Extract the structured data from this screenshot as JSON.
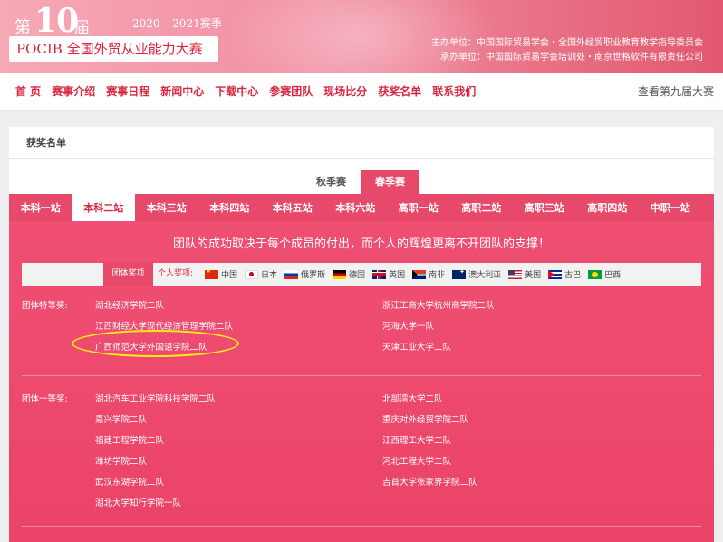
{
  "header": {
    "edition_prefix": "第",
    "edition_number": "10",
    "edition_suffix": "届",
    "season": "2020 – 2021赛季",
    "logo": "POCIB 全国外贸从业能力大赛",
    "organizer_line": "主办单位：中国国际贸易学会・全国外经贸职业教育教学指导委员会",
    "undertaker_line": "承办单位：中国国际贸易学会培训处・南京世格软件有限责任公司"
  },
  "nav": {
    "items": [
      "首 页",
      "赛事介绍",
      "赛事日程",
      "新闻中心",
      "下载中心",
      "参赛团队",
      "现场比分",
      "获奖名单",
      "联系我们"
    ],
    "right": "查看第九届大赛"
  },
  "panel": {
    "title": "获奖名单",
    "season_tabs": [
      "秋季赛",
      "春季赛"
    ],
    "active_season": "春季赛",
    "stations": [
      "本科一站",
      "本科二站",
      "本科三站",
      "本科四站",
      "本科五站",
      "本科六站",
      "高职一站",
      "高职二站",
      "高职三站",
      "高职四站",
      "中职一站"
    ],
    "active_station": "本科二站",
    "slogan": "团队的成功取决于每个成员的付出，而个人的辉煌更离不开团队的支撑！",
    "filter": {
      "team_award": "团体奖项",
      "personal_award": "个人奖项:",
      "countries": [
        {
          "name": "中国",
          "flag": "cn"
        },
        {
          "name": "日本",
          "flag": "jp"
        },
        {
          "name": "俄罗斯",
          "flag": "ru"
        },
        {
          "name": "德国",
          "flag": "de"
        },
        {
          "name": "英国",
          "flag": "uk"
        },
        {
          "name": "南非",
          "flag": "za"
        },
        {
          "name": "澳大利亚",
          "flag": "au"
        },
        {
          "name": "美国",
          "flag": "us"
        },
        {
          "name": "古巴",
          "flag": "cu"
        },
        {
          "name": "巴西",
          "flag": "br"
        }
      ]
    },
    "special_award": {
      "label": "团体特等奖:",
      "left": [
        "湖北经济学院二队",
        "江西财经大学现代经济管理学院二队",
        "广西师范大学外国语学院二队"
      ],
      "right": [
        "浙江工商大学杭州商学院二队",
        "河海大学一队",
        "天津工业大学二队"
      ]
    },
    "first_award": {
      "label": "团体一等奖:",
      "left": [
        "湖北汽车工业学院科技学院二队",
        "嘉兴学院二队",
        "福建工程学院二队",
        "潍坊学院二队",
        "武汉东湖学院二队",
        "湖北大学知行学院一队"
      ],
      "right": [
        "北部湾大学二队",
        "重庆对外经贸学院二队",
        "江西理工大学二队",
        "河北工程大学二队",
        "吉首大学张家界学院二队"
      ]
    },
    "highlight_color": "#f5ec1a"
  }
}
